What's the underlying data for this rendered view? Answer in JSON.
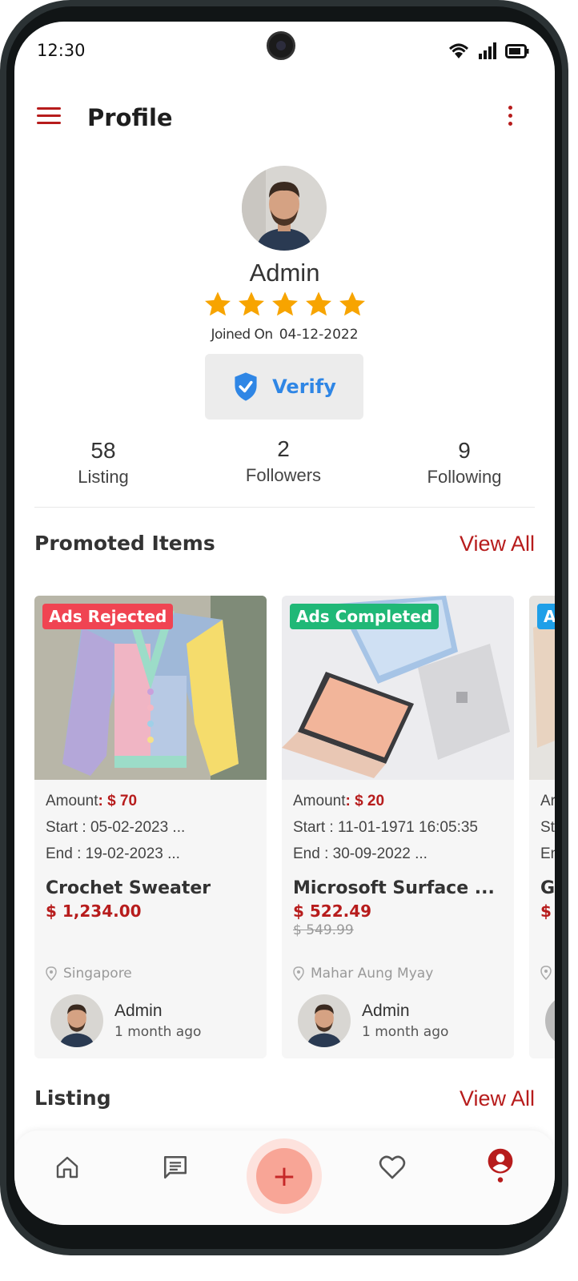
{
  "status_bar": {
    "time": "12:30"
  },
  "header": {
    "title": "Profile"
  },
  "profile": {
    "name": "Admin",
    "rating": 5,
    "rating_max": 5,
    "joined_label": "Joined On",
    "joined_date": "04-12-2022",
    "verify_label": "Verify"
  },
  "stats": [
    {
      "value": "58",
      "label": "Listing"
    },
    {
      "value": "2",
      "label": "Followers"
    },
    {
      "value": "9",
      "label": "Following"
    }
  ],
  "promoted": {
    "title": "Promoted Items",
    "view_all": "View All",
    "items": [
      {
        "badge": "Ads Rejected",
        "badge_color": "#f04452",
        "amount_label": "Amount",
        "amount_value": ": $ 70",
        "start": "Start : 05-02-2023 ...",
        "end": "End : 19-02-2023 ...",
        "title": "Crochet Sweater",
        "price": "$ 1,234.00",
        "old_price": "",
        "location": "Singapore",
        "owner": "Admin",
        "time_ago": "1 month ago"
      },
      {
        "badge": "Ads Completed",
        "badge_color": "#20b877",
        "amount_label": "Amount",
        "amount_value": ": $ 20",
        "start": "Start : 11-01-1971 16:05:35",
        "end": "End : 30-09-2022 ...",
        "title": "Microsoft Surface ...",
        "price": "$ 522.49",
        "old_price": "$ 549.99",
        "location": "Mahar Aung Myay",
        "owner": "Admin",
        "time_ago": "1 month ago"
      },
      {
        "badge": "A",
        "badge_color": "#1e9fe8",
        "amount_label": "Ar",
        "amount_value": "",
        "start": "St",
        "end": "En",
        "title": "G",
        "price": "$",
        "old_price": "",
        "location": "",
        "owner": "",
        "time_ago": ""
      }
    ]
  },
  "listing": {
    "title": "Listing",
    "view_all": "View All"
  },
  "bottom_nav": {
    "items": [
      "home-icon",
      "chat-icon",
      "add-icon",
      "heart-icon",
      "profile-icon"
    ],
    "add_symbol": "+",
    "active": "profile"
  },
  "colors": {
    "accent": "#b71c1c",
    "verify": "#2f86e5",
    "star": "#f7a400"
  }
}
